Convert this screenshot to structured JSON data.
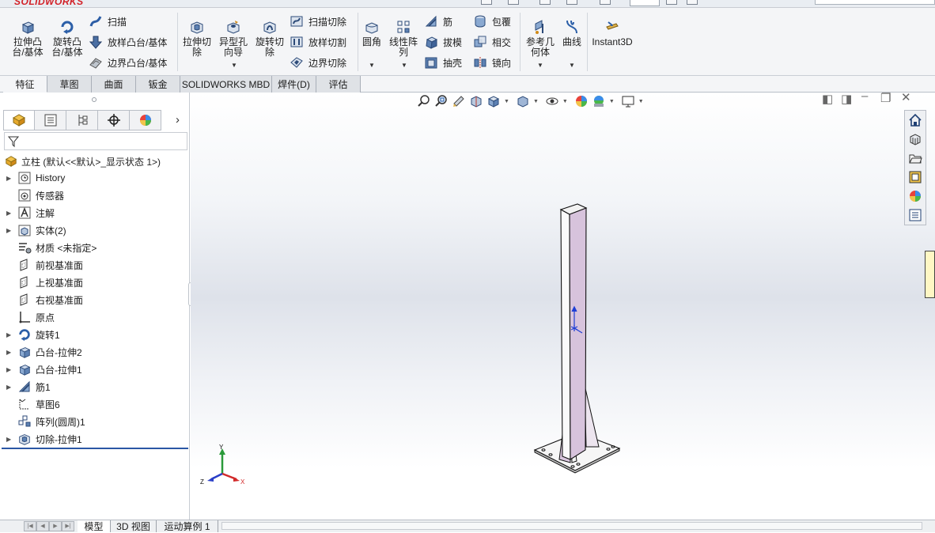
{
  "app": {
    "brand": "SOLIDWORKS",
    "colors": {
      "brand_red": "#d21f26",
      "ribbon_bg": "#f4f5f7",
      "part_face": "#f7f7f7",
      "part_side": "#d7c3dc",
      "rollback_bar": "#2b57a5",
      "edge_bar": "#fff7c4"
    }
  },
  "ribbon": {
    "extrude_boss": "拉伸凸台/基体",
    "revolve_boss": "旋转凸台/基体",
    "sweep": "扫描",
    "loft_boss": "放样凸台/基体",
    "boundary_boss": "边界凸台/基体",
    "extrude_cut": "拉伸切除",
    "hole_wizard": "异型孔向导",
    "revolve_cut": "旋转切除",
    "sweep_cut": "扫描切除",
    "loft_cut": "放样切割",
    "boundary_cut": "边界切除",
    "fillet": "圆角",
    "linear_pattern": "线性阵列",
    "rib": "筋",
    "draft": "拔模",
    "shell": "抽壳",
    "wrap": "包覆",
    "intersect": "相交",
    "mirror": "镜向",
    "ref_geometry": "参考几何体",
    "curves": "曲线",
    "instant3d": "Instant3D"
  },
  "tabs": [
    "特征",
    "草图",
    "曲面",
    "钣金",
    "SOLIDWORKS MBD",
    "焊件(D)",
    "评估"
  ],
  "feature_tree": {
    "root": "立柱  (默认<<默认>_显示状态 1>)",
    "items": [
      {
        "label": "History",
        "icon": "history-icon",
        "expandable": true
      },
      {
        "label": "传感器",
        "icon": "sensor-icon",
        "expandable": false
      },
      {
        "label": "注解",
        "icon": "annotation-icon",
        "expandable": true
      },
      {
        "label": "实体(2)",
        "icon": "solid-bodies-icon",
        "expandable": true
      },
      {
        "label": "材质 <未指定>",
        "icon": "material-icon",
        "expandable": false
      },
      {
        "label": "前视基准面",
        "icon": "plane-icon",
        "expandable": false
      },
      {
        "label": "上视基准面",
        "icon": "plane-icon",
        "expandable": false
      },
      {
        "label": "右视基准面",
        "icon": "plane-icon",
        "expandable": false
      },
      {
        "label": "原点",
        "icon": "origin-icon",
        "expandable": false
      },
      {
        "label": "旋转1",
        "icon": "revolve-feature-icon",
        "expandable": true
      },
      {
        "label": "凸台-拉伸2",
        "icon": "boss-extrude-icon",
        "expandable": true
      },
      {
        "label": "凸台-拉伸1",
        "icon": "boss-extrude-icon",
        "expandable": true
      },
      {
        "label": "筋1",
        "icon": "rib-feature-icon",
        "expandable": true
      },
      {
        "label": "草图6",
        "icon": "sketch-icon",
        "expandable": false
      },
      {
        "label": "阵列(圆周)1",
        "icon": "circular-pattern-icon",
        "expandable": false
      },
      {
        "label": "切除-拉伸1",
        "icon": "cut-extrude-icon",
        "expandable": true
      }
    ]
  },
  "triad": {
    "x": "X",
    "y": "Y",
    "z": "Z"
  },
  "bottom_tabs": [
    "模型",
    "3D 视图",
    "运动算例 1"
  ]
}
